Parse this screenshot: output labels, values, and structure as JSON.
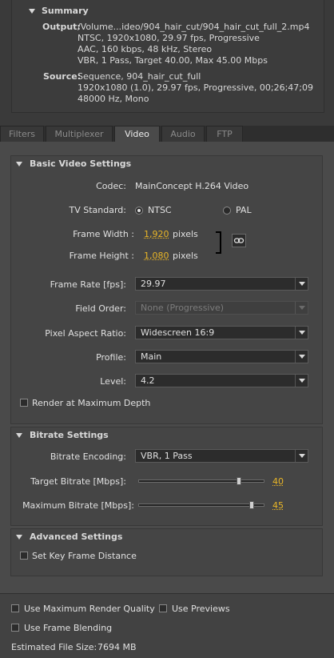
{
  "summary": {
    "title": "Summary",
    "output_label": "Output:",
    "output_lines": [
      "/Volume...ideo/904_hair_cut/904_hair_cut_full_2.mp4",
      "NTSC, 1920x1080, 29.97 fps, Progressive",
      "AAC, 160 kbps, 48 kHz, Stereo",
      "VBR, 1 Pass, Target 40.00, Max 45.00 Mbps"
    ],
    "source_label": "Source:",
    "source_lines": [
      "Sequence, 904_hair_cut_full",
      "1920x1080 (1.0), 29.97 fps, Progressive, 00;26;47;09",
      "48000 Hz, Mono"
    ]
  },
  "tabs": [
    {
      "label": "Filters",
      "active": false
    },
    {
      "label": "Multiplexer",
      "active": false
    },
    {
      "label": "Video",
      "active": true
    },
    {
      "label": "Audio",
      "active": false
    },
    {
      "label": "FTP",
      "active": false
    }
  ],
  "basic": {
    "title": "Basic Video Settings",
    "codec_label": "Codec:",
    "codec_value": "MainConcept H.264 Video",
    "tv_label": "TV Standard:",
    "ntsc": "NTSC",
    "pal": "PAL",
    "tv_selected": "NTSC",
    "fw_label": "Frame Width :",
    "fw_value": "1,920",
    "fh_label": "Frame Height :",
    "fh_value": "1,080",
    "pixels": "pixels",
    "fr_label": "Frame Rate [fps]:",
    "fr_value": "29.97",
    "fo_label": "Field Order:",
    "fo_value": "None (Progressive)",
    "par_label": "Pixel Aspect Ratio:",
    "par_value": "Widescreen 16:9",
    "profile_label": "Profile:",
    "profile_value": "Main",
    "level_label": "Level:",
    "level_value": "4.2",
    "max_depth": "Render at Maximum Depth",
    "max_depth_checked": false
  },
  "bitrate": {
    "title": "Bitrate Settings",
    "enc_label": "Bitrate Encoding:",
    "enc_value": "VBR, 1 Pass",
    "target_label": "Target Bitrate [Mbps]:",
    "target_value": "40",
    "target_fraction": 0.8,
    "max_label": "Maximum Bitrate [Mbps]:",
    "max_value": "45",
    "max_fraction": 0.9
  },
  "advanced": {
    "title": "Advanced Settings",
    "key_frame": "Set Key Frame Distance",
    "key_frame_checked": false
  },
  "bottom": {
    "max_render": "Use Maximum Render Quality",
    "previews": "Use Previews",
    "blending": "Use Frame Blending",
    "filesize_label": "Estimated File Size:",
    "filesize_value": "7694 MB"
  },
  "icons": {
    "link": "chain-link-icon"
  }
}
